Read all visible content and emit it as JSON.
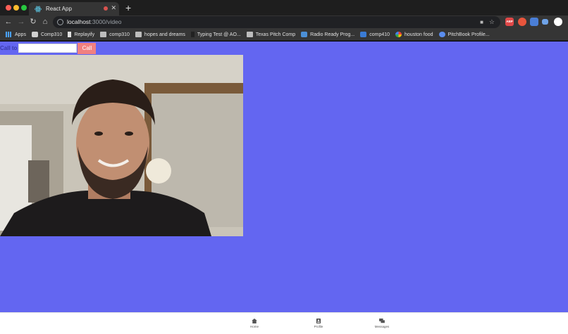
{
  "browser": {
    "tab_title": "React App",
    "new_tab_symbol": "+",
    "close_symbol": "✕",
    "url_host": "localhost",
    "url_path": ":3000/video"
  },
  "bookmarks": [
    {
      "label": "Apps",
      "icon": "apps-grid-icon"
    },
    {
      "label": "Comp310",
      "icon": "site-icon"
    },
    {
      "label": "Replayify",
      "icon": "site-icon"
    },
    {
      "label": "comp310",
      "icon": "folder-icon"
    },
    {
      "label": "hopes and dreams",
      "icon": "folder-icon"
    },
    {
      "label": "Typing Test @ AO...",
      "icon": "site-icon"
    },
    {
      "label": "Texas Pitch Comp",
      "icon": "folder-icon"
    },
    {
      "label": "Radio Ready Prog...",
      "icon": "site-icon"
    },
    {
      "label": "comp410",
      "icon": "site-icon"
    },
    {
      "label": "houston food",
      "icon": "google-maps-icon"
    },
    {
      "label": "PitchBook Profile...",
      "icon": "site-icon"
    }
  ],
  "extensions": {
    "abp_label": "ABP"
  },
  "call": {
    "label": "Call to",
    "input_value": "",
    "button_label": "Call"
  },
  "bottom_nav": [
    {
      "label": "Home",
      "icon": "home-icon"
    },
    {
      "label": "Profile",
      "icon": "profile-icon"
    },
    {
      "label": "Messages",
      "icon": "messages-icon"
    }
  ],
  "colors": {
    "page_bg": "#6366f1",
    "call_button": "#f08080"
  }
}
